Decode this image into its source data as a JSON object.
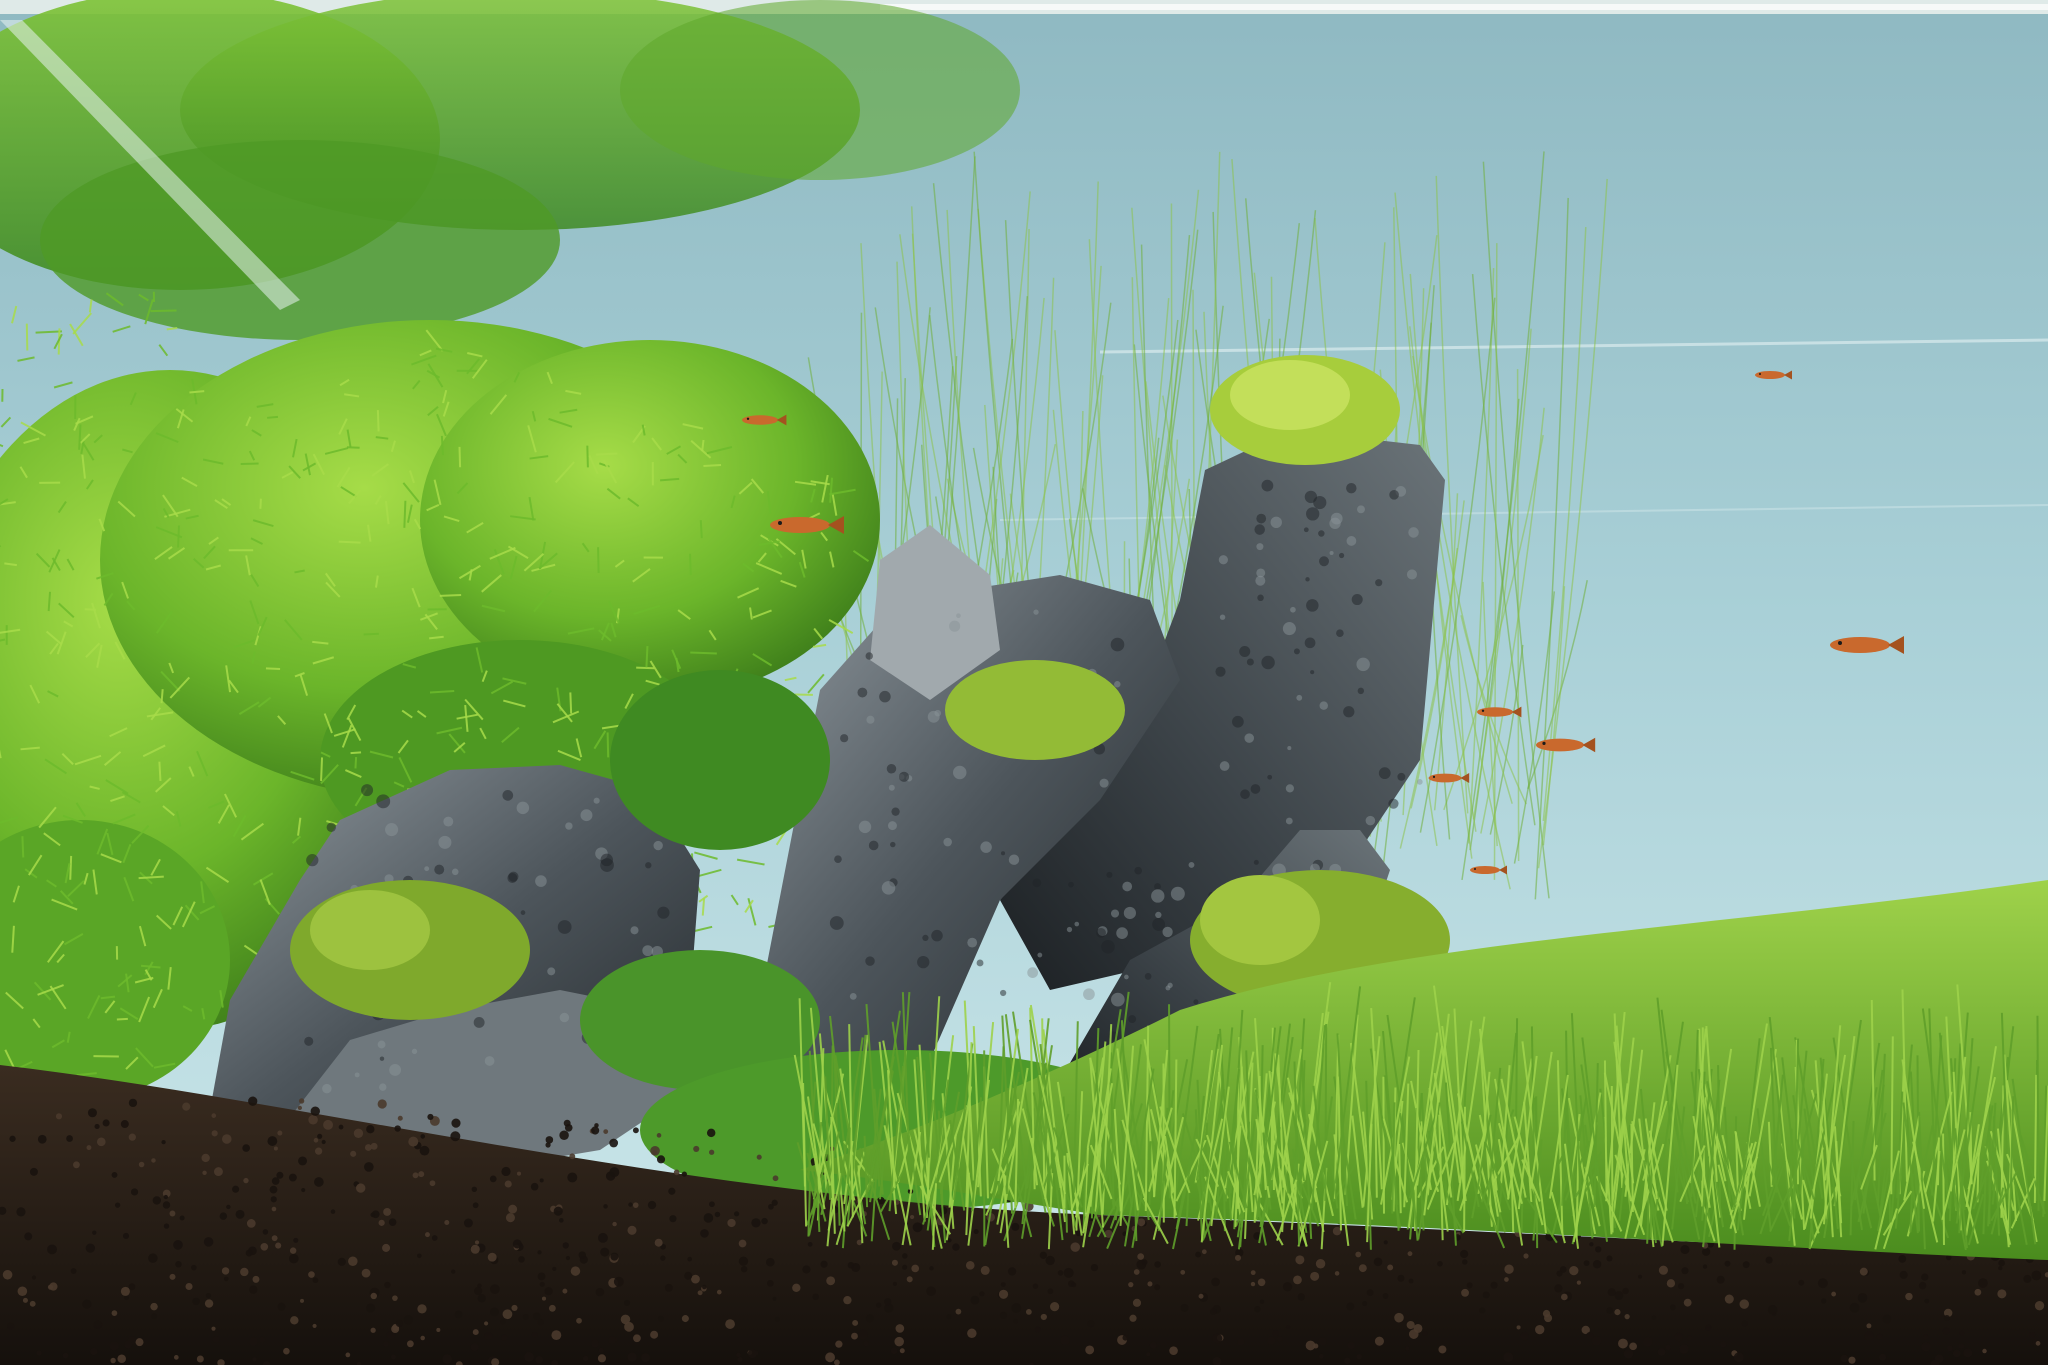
{
  "scene": {
    "colors": {
      "water_top": "#9fc7cf",
      "water_mid": "#aed3da",
      "water_bottom": "#c9e6ea",
      "foliage_dark": "#3f8a1e",
      "foliage_mid": "#6dbb2c",
      "foliage_light": "#a8dc4a",
      "moss": "#9fc63a",
      "grass": "#7fbf34",
      "rock_dark": "#2b3034",
      "rock_mid": "#555d63",
      "rock_light": "#9aa3a8",
      "soil": "#2a1f18",
      "soil_light": "#4a3a2c",
      "fish": "#c9692d",
      "glass_edge": "#e8f2f0"
    },
    "fish_count": 8
  }
}
